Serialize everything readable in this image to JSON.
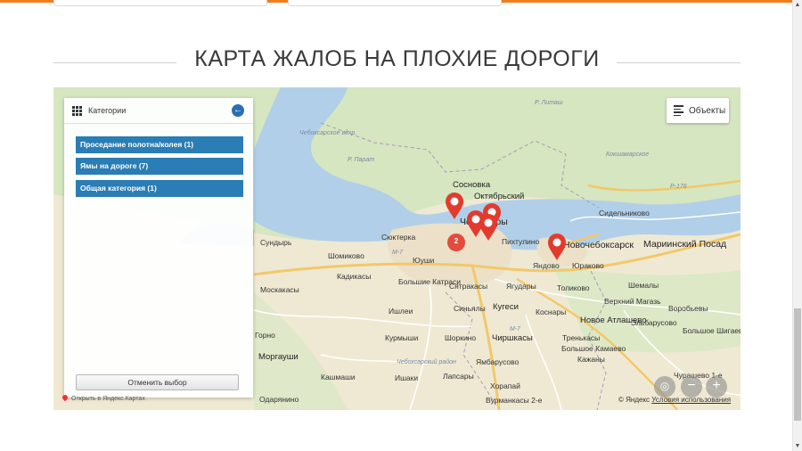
{
  "colors": {
    "accent": "#f07c1e",
    "category": "#2a7db5",
    "marker": "#e23b2e"
  },
  "title": "КАРТА ЖАЛОБ НА ПЛОХИЕ ДОРОГИ",
  "map": {
    "objects_button": "Объекты",
    "panel": {
      "title": "Категории",
      "back_icon": "arrow-left-icon",
      "categories": [
        {
          "label": "Проседание полотна/колея (1)"
        },
        {
          "label": "Ямы на дороге (7)"
        },
        {
          "label": "Общая категория (1)"
        }
      ],
      "cancel_label": "Отменить выбор"
    },
    "cluster_count": "2",
    "copyright_left": "Открыть в Яндекс.Картах",
    "copyright": "© Яндекс",
    "terms": "Условия использования",
    "zoom_out": "−",
    "zoom_in": "+",
    "places": {
      "sosnovka": "Сосновка",
      "oktyabrsky": "Октябрьский",
      "cheboksary": "Чебоксары",
      "novocheboksarsk": "Новочебоксарск",
      "mariinsky": "Мариинский Посад",
      "sidelnikovo": "Сидельниково",
      "syundyr": "Сундырь",
      "shomikovo": "Шомиково",
      "syukteрka": "Сюктерка",
      "yushi": "Юуши",
      "kadikasy": "Кадикасы",
      "mosk": "Москакасы",
      "bolshie_katrasi": "Большие Катраси",
      "syatrakasy": "Сятракасы",
      "yagudary": "Ягудары",
      "pikhtulino": "Пихтулино",
      "yandovo": "Яндово",
      "yurakovo": "Юраково",
      "tolikovo": "Толиково",
      "sinyaly": "Синьялы",
      "kugesi": "Кугеси",
      "kosnary": "Коснары",
      "novoe_atlashevo": "Новое Атлашево",
      "verhniy": "Верхний Магазь",
      "elbarusovo": "Эльбарусово",
      "bolshoe_shigaevo": "Большое Шигаево",
      "ishley": "Ишлеи",
      "kurmyshi": "Курмыши",
      "shorkino": "Шоркино",
      "chirshkasy": "Чиршкасы",
      "treniakasy": "Тренькасы",
      "bolshoe_kamaevo": "Большое Камаево",
      "kazhany": "Кажаны",
      "yambarusovo": "Ямбарусово",
      "lapsary": "Лапсары",
      "khorapay": "Хорапай",
      "morgaushi": "Моргауши",
      "kashmashi": "Кашмаши",
      "ishaki": "Ишаки",
      "vurmankasy": "Вурманкасы 2-е",
      "odaryanino": "Одарянино",
      "churashevo": "Чурашево 1-е",
      "gorno": "Горно",
      "shemaly": "Шемалы",
      "vorobevy": "Воробьевы",
      "reservoir": "Чебоксарское вдхр.",
      "kokshamar": "Кокшамарское",
      "cheb_rayon": "Чебоксарский район",
      "r_parat": "Р. Парат",
      "r_ilet": "Р. Литаш",
      "p176": "Р-176",
      "m7": "М-7",
      "m7b": "М-7"
    }
  }
}
